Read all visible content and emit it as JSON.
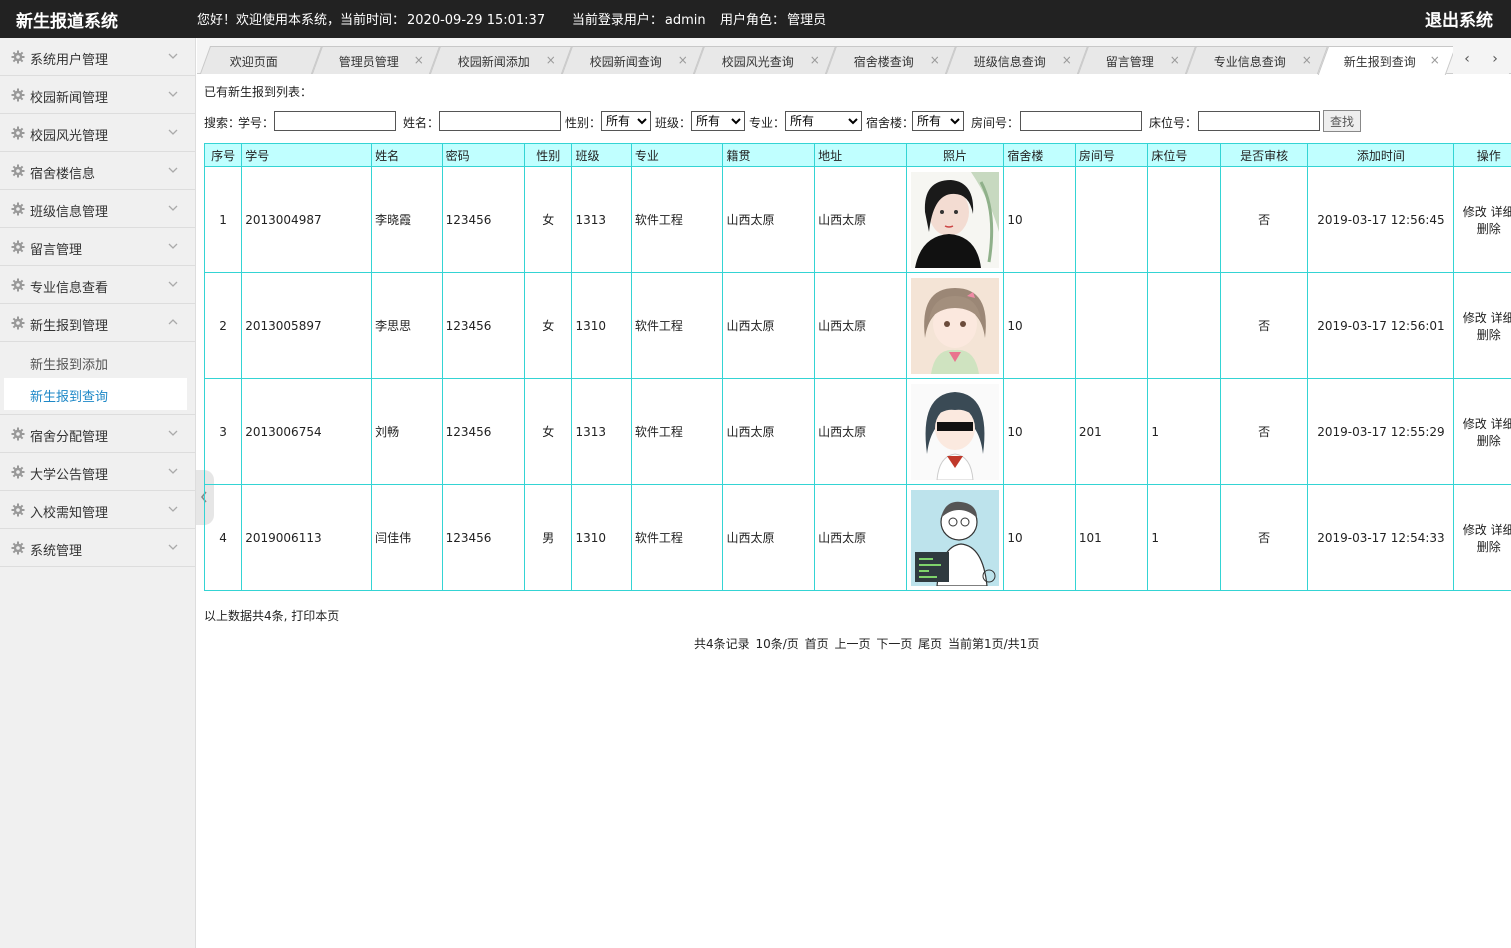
{
  "header": {
    "title": "新生报道系统",
    "welcome": "您好！欢迎使用本系统，当前时间：",
    "time": "2020-09-29 15:01:37",
    "user_label": "当前登录用户：",
    "user": "admin",
    "role_label": "用户角色：",
    "role": "管理员",
    "logout": "退出系统"
  },
  "sidebar": {
    "items": [
      {
        "label": "系统用户管理"
      },
      {
        "label": "校园新闻管理"
      },
      {
        "label": "校园风光管理"
      },
      {
        "label": "宿舍楼信息"
      },
      {
        "label": "班级信息管理"
      },
      {
        "label": "留言管理"
      },
      {
        "label": "专业信息查看"
      },
      {
        "label": "新生报到管理"
      },
      {
        "label": "宿舍分配管理"
      },
      {
        "label": "大学公告管理"
      },
      {
        "label": "入校需知管理"
      },
      {
        "label": "系统管理"
      }
    ],
    "sub_items": [
      {
        "label": "新生报到添加"
      },
      {
        "label": "新生报到查询"
      }
    ]
  },
  "tabs": [
    {
      "label": "欢迎页面"
    },
    {
      "label": "管理员管理"
    },
    {
      "label": "校园新闻添加"
    },
    {
      "label": "校园新闻查询"
    },
    {
      "label": "校园风光查询"
    },
    {
      "label": "宿舍楼查询"
    },
    {
      "label": "班级信息查询"
    },
    {
      "label": "留言管理"
    },
    {
      "label": "专业信息查询"
    },
    {
      "label": "新生报到查询"
    }
  ],
  "tab_close": "×",
  "tab_prev": "‹",
  "tab_next": "›",
  "list_title": "已有新生报到列表：",
  "search": {
    "prefix": "搜索：",
    "student_no_label": "学号：",
    "name_label": "姓名：",
    "gender_label": "性别：",
    "gender_value": "所有",
    "class_label": "班级：",
    "class_value": "所有",
    "major_label": "专业：",
    "major_value": "所有",
    "dorm_label": "宿舍楼：",
    "dorm_value": "所有",
    "room_label": "房间号：",
    "bed_label": "床位号：",
    "button": "查找"
  },
  "table": {
    "headers": [
      "序号",
      "学号",
      "姓名",
      "密码",
      "性别",
      "班级",
      "专业",
      "籍贯",
      "地址",
      "照片",
      "宿舍楼",
      "房间号",
      "床位号",
      "是否审核",
      "添加时间",
      "操作"
    ],
    "rows": [
      {
        "no": "1",
        "sid": "2013004987",
        "name": "李晓霞",
        "pwd": "123456",
        "gender": "女",
        "cls": "1313",
        "major": "软件工程",
        "native": "山西太原",
        "addr": "山西太原",
        "dorm": "10",
        "room": "",
        "bed": "",
        "audit": "否",
        "time": "2019-03-17 12:56:45"
      },
      {
        "no": "2",
        "sid": "2013005897",
        "name": "李思思",
        "pwd": "123456",
        "gender": "女",
        "cls": "1310",
        "major": "软件工程",
        "native": "山西太原",
        "addr": "山西太原",
        "dorm": "10",
        "room": "",
        "bed": "",
        "audit": "否",
        "time": "2019-03-17 12:56:01"
      },
      {
        "no": "3",
        "sid": "2013006754",
        "name": "刘畅",
        "pwd": "123456",
        "gender": "女",
        "cls": "1313",
        "major": "软件工程",
        "native": "山西太原",
        "addr": "山西太原",
        "dorm": "10",
        "room": "201",
        "bed": "1",
        "audit": "否",
        "time": "2019-03-17 12:55:29"
      },
      {
        "no": "4",
        "sid": "2019006113",
        "name": "闫佳伟",
        "pwd": "123456",
        "gender": "男",
        "cls": "1310",
        "major": "软件工程",
        "native": "山西太原",
        "addr": "山西太原",
        "dorm": "10",
        "room": "101",
        "bed": "1",
        "audit": "否",
        "time": "2019-03-17 12:54:33"
      }
    ],
    "op_edit": "修改",
    "op_detail": "详细",
    "op_delete": "删除"
  },
  "footer_note": "以上数据共4条, 打印本页",
  "pager": {
    "total": "共4条记录",
    "per_page": "10条/页",
    "first": "首页",
    "prev": "上一页",
    "next": "下一页",
    "last": "尾页",
    "current": "当前第1页/共1页"
  },
  "colors": {
    "header_bg": "#222222",
    "table_header_bg": "#c0ffff",
    "table_border": "#34d4d4",
    "active_sub": "#1e88c7"
  }
}
